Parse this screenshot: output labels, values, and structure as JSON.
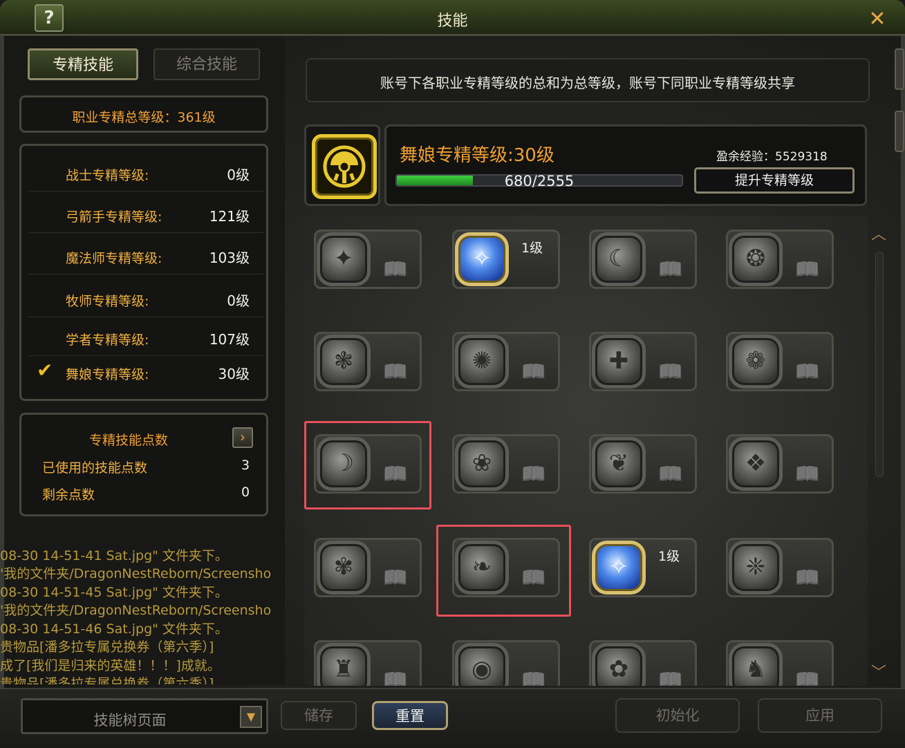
{
  "window": {
    "title": "技能",
    "help_label": "?",
    "close_label": "✕"
  },
  "tabs": [
    {
      "label": "专精技能",
      "active": true
    },
    {
      "label": "综合技能",
      "active": false
    }
  ],
  "total_level": "职业专精总等级：361级",
  "classes": [
    {
      "name": "战士专精等级:",
      "value": "0级",
      "selected": false
    },
    {
      "name": "弓箭手专精等级:",
      "value": "121级",
      "selected": false
    },
    {
      "name": "魔法师专精等级:",
      "value": "103级",
      "selected": false
    },
    {
      "name": "牧师专精等级:",
      "value": "0级",
      "selected": false
    },
    {
      "name": "学者专精等级:",
      "value": "107级",
      "selected": false
    },
    {
      "name": "舞娘专精等级:",
      "value": "30级",
      "selected": true
    }
  ],
  "skill_points": {
    "title": "专精技能点数",
    "arrow": "›",
    "used_label": "已使用的技能点数",
    "used_value": "3",
    "remaining_label": "剩余点数",
    "remaining_value": "0"
  },
  "chat_log": [
    "08-30 14-51-41 Sat.jpg\" 文件夹下。",
    "'我的文件夹/DragonNestReborn/Screensho",
    "08-30 14-51-45 Sat.jpg\" 文件夹下。",
    "'我的文件夹/DragonNestReborn/Screensho",
    "08-30 14-51-46 Sat.jpg\" 文件夹下。",
    "贵物品[潘多拉专属兑换券（第六季）]",
    "成了[我们是归来的英雄！！！]成就。",
    "贵物品[潘多拉专属兑换券（第六季）]"
  ],
  "info_text": "账号下各职业专精等级的总和为总等级，账号下同职业专精等级共享",
  "spec": {
    "title": "舞娘专精等级:30级",
    "surplus_exp": "盈余经验：5529318",
    "progress_text": "680/2555",
    "progress_current": 680,
    "progress_max": 2555,
    "upgrade_label": "提升专精等级"
  },
  "skills": [
    {
      "icon": "dancer-figure-icon",
      "active": false,
      "level": ""
    },
    {
      "icon": "blue-spiral-icon",
      "active": true,
      "level": "1级"
    },
    {
      "icon": "crescent-slash-icon",
      "active": false,
      "level": ""
    },
    {
      "icon": "flame-swirl-icon",
      "active": false,
      "level": ""
    },
    {
      "icon": "vortex-icon",
      "active": false,
      "level": ""
    },
    {
      "icon": "wing-burst-icon",
      "active": false,
      "level": ""
    },
    {
      "icon": "mp-buff-icon",
      "active": false,
      "level": ""
    },
    {
      "icon": "twirl-dancer-icon",
      "active": false,
      "level": ""
    },
    {
      "icon": "crescent-wave-icon",
      "active": false,
      "level": ""
    },
    {
      "icon": "swirl-serpent-icon",
      "active": false,
      "level": ""
    },
    {
      "icon": "heart-wing-icon",
      "active": false,
      "level": ""
    },
    {
      "icon": "phoenix-icon",
      "active": false,
      "level": ""
    },
    {
      "icon": "knot-icon",
      "active": false,
      "level": ""
    },
    {
      "icon": "feather-slash-icon",
      "active": false,
      "level": ""
    },
    {
      "icon": "blue-leap-icon",
      "active": true,
      "level": "1级"
    },
    {
      "icon": "mask-icon",
      "active": false,
      "level": ""
    },
    {
      "icon": "tower-icon",
      "active": false,
      "level": ""
    },
    {
      "icon": "eye-icon",
      "active": false,
      "level": ""
    },
    {
      "icon": "beast-icon",
      "active": false,
      "level": ""
    },
    {
      "icon": "kneeling-figure-icon",
      "active": false,
      "level": ""
    }
  ],
  "bottom": {
    "tree_select": "技能树页面",
    "save_label": "储存",
    "reset_label": "重置",
    "init_label": "初始化",
    "apply_label": "应用"
  }
}
